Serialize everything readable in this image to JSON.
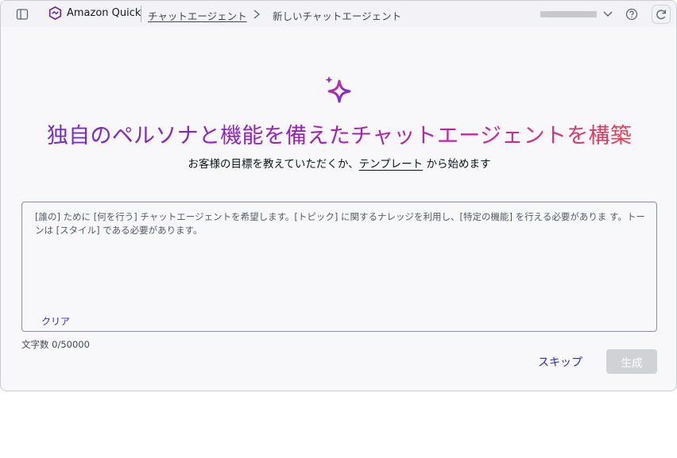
{
  "header": {
    "brand": "Amazon Quick",
    "breadcrumb_link": "チャットエージェント",
    "breadcrumb_current": "新しいチャットエージェント",
    "icons": [
      "sidebar-toggle-icon",
      "amazon-quick-logo",
      "chevron-right-icon",
      "chevron-down-icon",
      "help-icon",
      "refresh-icon"
    ]
  },
  "hero": {
    "icon": "sparkle-icon",
    "title": "独自のペルソナと機能を備えたチャットエージェントを構築",
    "subtitle_before": "お客様の目標を教えていただくか、",
    "subtitle_link": "テンプレート",
    "subtitle_after": " から始めます",
    "gradient_colors": [
      "#6a2fd0",
      "#9c1fb8",
      "#c822a2",
      "#f04a3a"
    ]
  },
  "prompt": {
    "value": "",
    "placeholder": "[誰の] ために [何を行う] チャットエージェントを希望します。[トピック] に関するナレッジを利用し、[特定の機能] を行える必要がありま す。トーンは [スタイル] である必要があります。",
    "clear_label": "クリア",
    "char_count": "文字数 0/50000"
  },
  "actions": {
    "skip_label": "スキップ",
    "generate_label": "生成"
  },
  "colors": {
    "link": "#2a2ad0",
    "disabled_button": "#d0d2d6"
  }
}
